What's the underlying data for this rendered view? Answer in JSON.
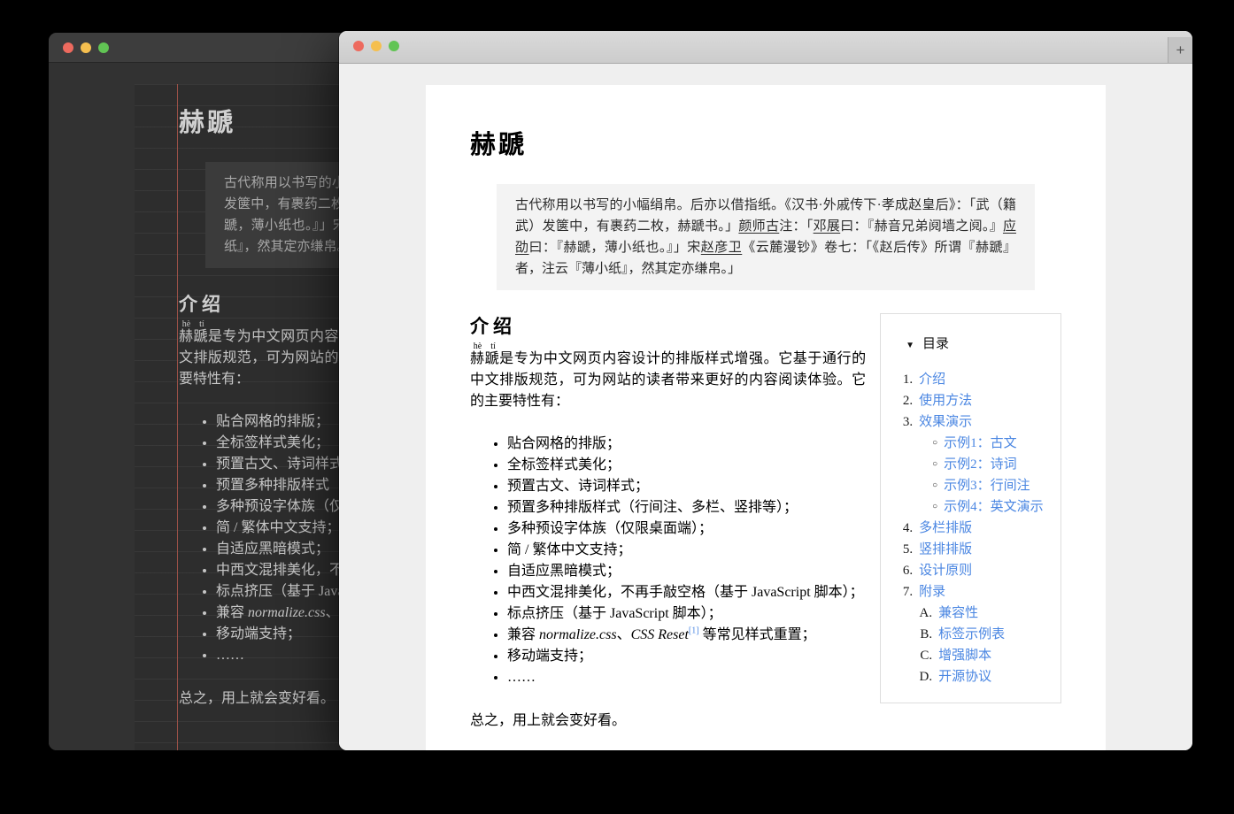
{
  "chrome": {
    "plus_label": "+",
    "traffic_colors": {
      "close": "#ed6a5e",
      "minimize": "#f5bf4f",
      "zoom": "#61c454"
    }
  },
  "colors": {
    "link_blue": "#4a86e2",
    "grid_red_line": "#9b5147",
    "dark_window_bg": "#323232",
    "light_page_bg": "#efefef"
  },
  "article": {
    "title": "赫蹏",
    "quote_segments": [
      {
        "t": "古代称用以书写的小幅绢帛。后亦以借指纸。《汉书·外戚传下·孝成赵皇后》：「武（籍武）发箧中，有裹药二枚，赫蹏书。」"
      },
      {
        "t": "颜师古",
        "style": "name"
      },
      {
        "t": "注：「"
      },
      {
        "t": "邓展",
        "style": "name"
      },
      {
        "t": "曰：『赫音兄弟阋墙之阋。』"
      },
      {
        "t": "应劭",
        "style": "name"
      },
      {
        "t": "曰：『赫蹏，薄小纸也。』」宋"
      },
      {
        "t": "赵彦卫",
        "style": "name"
      },
      {
        "t": "《云麓漫钞》卷七：「《赵后传》所谓『赫蹏』者，注云『薄小纸』，然其定亦缣帛。」"
      }
    ],
    "intro_heading": "介绍",
    "intro_ruby_base": "赫蹏",
    "intro_ruby_text": "hè tí",
    "intro_text": "是专为中文网页内容设计的排版样式增强。它基于通行的中文排版规范，可为网站的读者带来更好的内容阅读体验。它的主要特性有：",
    "features": [
      [
        {
          "t": "贴合网格的排版；"
        }
      ],
      [
        {
          "t": "全标签样式美化；"
        }
      ],
      [
        {
          "t": "预置古文、诗词样式；"
        }
      ],
      [
        {
          "t": "预置多种排版样式（行间注、多栏、竖排等）；"
        }
      ],
      [
        {
          "t": "多种预设字体族（仅限桌面端）；"
        }
      ],
      [
        {
          "t": "简 / 繁体中文支持；"
        }
      ],
      [
        {
          "t": "自适应黑暗模式；"
        }
      ],
      [
        {
          "t": "中西文混排美化，不再手敲空格（基于 JavaScript 脚本）；"
        }
      ],
      [
        {
          "t": "标点挤压（基于 JavaScript 脚本）；"
        }
      ],
      [
        {
          "t": "兼容 "
        },
        {
          "t": "normalize.css",
          "style": "italic"
        },
        {
          "t": "、"
        },
        {
          "t": "CSS Reset",
          "style": "italic"
        },
        {
          "t": "[1]",
          "style": "ref"
        },
        {
          "t": " 等常见样式重置；"
        }
      ],
      [
        {
          "t": "移动端支持；"
        }
      ],
      [
        {
          "t": "……"
        }
      ]
    ],
    "closing": "总之，用上就会变好看。"
  },
  "toc": {
    "marker": "▼",
    "title": "目录",
    "items": [
      {
        "marker": "1.",
        "label": "介绍",
        "type": "num"
      },
      {
        "marker": "2.",
        "label": "使用方法",
        "type": "num"
      },
      {
        "marker": "3.",
        "label": "效果演示",
        "type": "num"
      },
      {
        "marker": "○",
        "label": "示例1：古文",
        "type": "circle"
      },
      {
        "marker": "○",
        "label": "示例2：诗词",
        "type": "circle"
      },
      {
        "marker": "○",
        "label": "示例3：行间注",
        "type": "circle"
      },
      {
        "marker": "○",
        "label": "示例4：英文演示",
        "type": "circle"
      },
      {
        "marker": "4.",
        "label": "多栏排版",
        "type": "num"
      },
      {
        "marker": "5.",
        "label": "竖排排版",
        "type": "num"
      },
      {
        "marker": "6.",
        "label": "设计原则",
        "type": "num"
      },
      {
        "marker": "7.",
        "label": "附录",
        "type": "num"
      },
      {
        "marker": "A.",
        "label": "兼容性",
        "type": "letter"
      },
      {
        "marker": "B.",
        "label": "标签示例表",
        "type": "letter"
      },
      {
        "marker": "C.",
        "label": "增强脚本",
        "type": "letter"
      },
      {
        "marker": "D.",
        "label": "开源协议",
        "type": "letter"
      }
    ]
  }
}
